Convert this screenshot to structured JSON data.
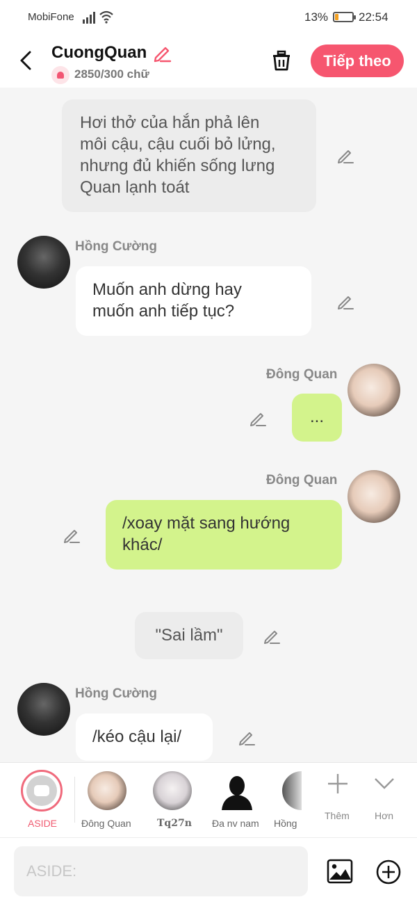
{
  "status_bar": {
    "carrier": "MobiFone",
    "battery": "13%",
    "battery_level": 0.13,
    "time": "22:54"
  },
  "header": {
    "title": "CuongQuan",
    "word_count": "2850/300 chữ",
    "next_label": "Tiếp theo"
  },
  "messages": [
    {
      "type": "narration",
      "lines": [
        "Hơi thở của hắn phả lên",
        "môi cậu, cậu cuối bỏ lửng,",
        "nhưng đủ khiến sống lưng",
        "Quan lạnh toát"
      ]
    },
    {
      "type": "left",
      "name": "Hồng Cường",
      "lines": [
        "Muốn anh dừng hay",
        "muốn anh tiếp tục?"
      ]
    },
    {
      "type": "right",
      "name": "Đông Quan",
      "lines": [
        "..."
      ]
    },
    {
      "type": "right",
      "name": "Đông Quan",
      "lines": [
        "/xoay mặt sang hướng",
        "khác/"
      ]
    },
    {
      "type": "center",
      "lines": [
        "\"Sai lầm\""
      ]
    },
    {
      "type": "left",
      "name": "Hồng Cường",
      "lines": [
        "/kéo cậu lại/"
      ]
    }
  ],
  "character_bar": {
    "aside_label": "ASIDE",
    "characters": [
      "Đông Quan",
      "Tq27n",
      "Đa nv nam",
      "Hồng"
    ],
    "add_label": "Thêm",
    "more_label": "Hơn"
  },
  "input": {
    "placeholder": "ASIDE:"
  },
  "colors": {
    "accent": "#f6566f",
    "green_bubble": "#d3f38c",
    "narration_bubble": "#ececec"
  }
}
